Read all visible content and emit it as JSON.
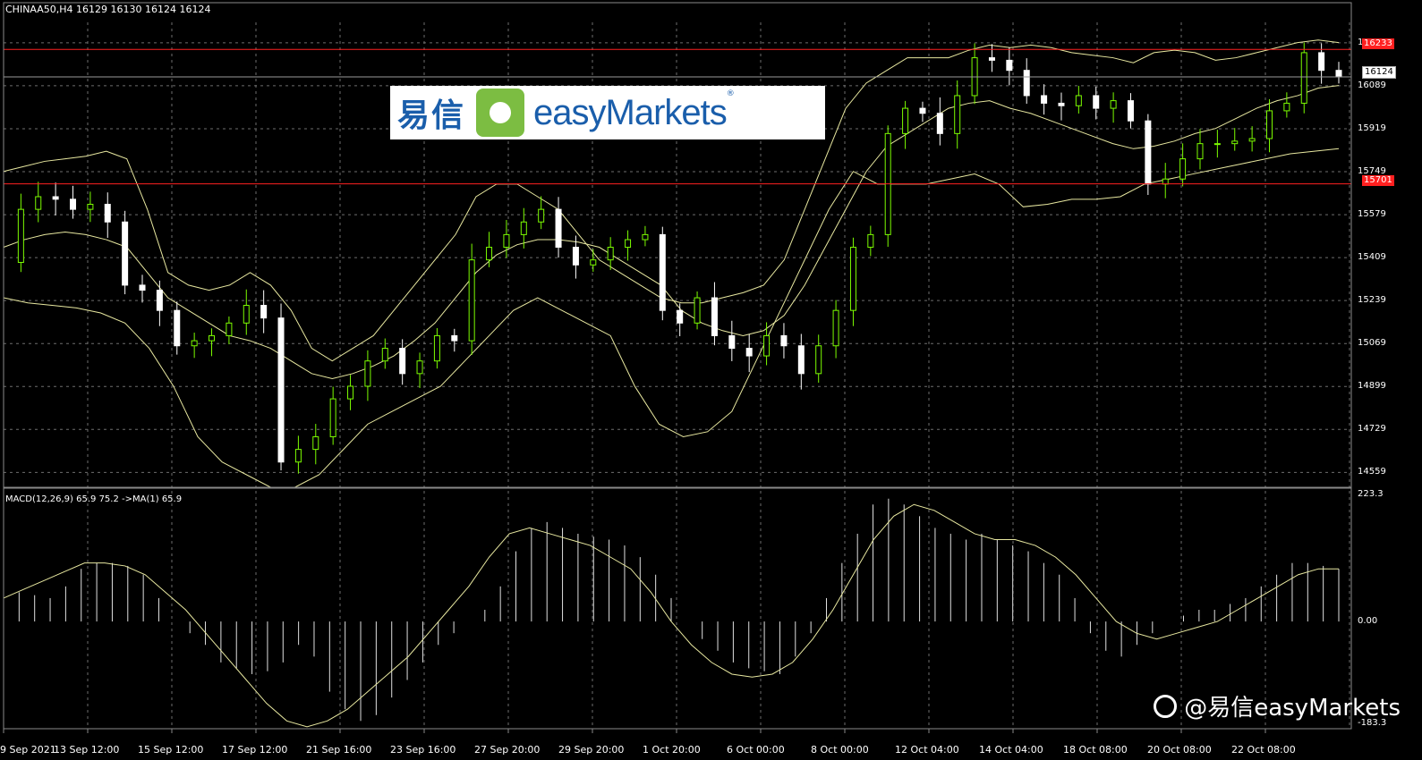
{
  "header": {
    "symbol_info": "CHINAA50,H4  16129 16130 16124 16124",
    "macd_info": "MACD(12,26,9) 65.9 75.2  ->MA(1) 65.9"
  },
  "price_axis": {
    "ticks": [
      "16259",
      "16089",
      "15919",
      "15749",
      "15579",
      "15409",
      "15239",
      "15069",
      "14899",
      "14729",
      "14559"
    ],
    "labels": {
      "resistance": "16233",
      "current": "16124",
      "support": "15701"
    }
  },
  "macd_axis": {
    "ticks": [
      "223.3",
      "0.00",
      "-183.3"
    ]
  },
  "time_axis": {
    "ticks": [
      "9 Sep 2021",
      "13 Sep 12:00",
      "15 Sep 12:00",
      "17 Sep 12:00",
      "21 Sep 16:00",
      "23 Sep 16:00",
      "27 Sep 20:00",
      "29 Sep 20:00",
      "1 Oct 20:00",
      "6 Oct 00:00",
      "8 Oct 00:00",
      "12 Oct 04:00",
      "14 Oct 04:00",
      "18 Oct 08:00",
      "20 Oct 08:00",
      "22 Oct 08:00"
    ]
  },
  "logo": {
    "cn": "易信",
    "en": "easyMarkets",
    "reg": "®"
  },
  "watermark": {
    "text": "@易信easyMarkets",
    "icon": "weibo-icon"
  },
  "colors": {
    "background": "#000000",
    "bull": "#7cfc00",
    "bear": "#ffffff",
    "band": "#e8e8a0",
    "hline": "#ff2020",
    "grid": "#6e6e6e",
    "brand_blue": "#1a5eab",
    "brand_green": "#7cbd42"
  },
  "chart_data": [
    {
      "type": "line",
      "title": "CHINAA50,H4",
      "description_values": {
        "ylim": [
          14500,
          16340
        ],
        "horizontal_levels": [
          16233,
          15701
        ],
        "last_price": 16124,
        "close_series": [
          15390,
          15600,
          15650,
          15640,
          15600,
          15620,
          15550,
          15300,
          15280,
          15200,
          15060,
          15080,
          15100,
          15150,
          15220,
          15170,
          14600,
          14650,
          14700,
          14850,
          14900,
          15000,
          15050,
          14950,
          15000,
          15100,
          15080,
          15400,
          15450,
          15500,
          15550,
          15600,
          15450,
          15380,
          15400,
          15450,
          15480,
          15500,
          15200,
          15150,
          15250,
          15100,
          15050,
          15020,
          15100,
          15060,
          14950,
          15060,
          15200,
          15450,
          15500,
          15900,
          16000,
          15980,
          15900,
          16050,
          16200,
          16190,
          16150,
          16050,
          16020,
          16010,
          16050,
          16000,
          16030,
          15950,
          15700,
          15720,
          15800,
          15860,
          15860,
          15870,
          15880,
          15990,
          16020,
          16220,
          16150,
          16124
        ]
      },
      "series": [
        {
          "name": "upper",
          "values": [
            15750,
            15770,
            15790,
            15800,
            15810,
            15830,
            15800,
            15600,
            15350,
            15300,
            15280,
            15300,
            15350,
            15300,
            15200,
            15050,
            15000,
            15050,
            15100,
            15200,
            15300,
            15400,
            15500,
            15650,
            15700,
            15700,
            15650,
            15600,
            15500,
            15400,
            15350,
            15300,
            15250,
            15230,
            15230,
            15250,
            15270,
            15300,
            15400,
            15600,
            15800,
            16000,
            16100,
            16150,
            16200,
            16200,
            16200,
            16230,
            16250,
            16240,
            16250,
            16240,
            16220,
            16210,
            16200,
            16180,
            16220,
            16230,
            16220,
            16190,
            16200,
            16220,
            16240,
            16260,
            16270,
            16260
          ]
        },
        {
          "name": "middle",
          "values": [
            15450,
            15480,
            15500,
            15510,
            15500,
            15480,
            15450,
            15350,
            15250,
            15200,
            15150,
            15100,
            15080,
            15050,
            15000,
            14950,
            14930,
            14950,
            14980,
            15020,
            15080,
            15150,
            15250,
            15350,
            15420,
            15460,
            15480,
            15480,
            15470,
            15450,
            15400,
            15350,
            15300,
            15200,
            15150,
            15120,
            15100,
            15120,
            15180,
            15300,
            15450,
            15600,
            15750,
            15850,
            15900,
            15950,
            16000,
            16020,
            16030,
            16000,
            15980,
            15950,
            15920,
            15890,
            15860,
            15840,
            15850,
            15870,
            15900,
            15920,
            15960,
            16000,
            16030,
            16050,
            16080,
            16090
          ]
        },
        {
          "name": "lower",
          "values": [
            15250,
            15230,
            15220,
            15210,
            15190,
            15150,
            15050,
            14900,
            14700,
            14600,
            14550,
            14500,
            14500,
            14550,
            14650,
            14750,
            14800,
            14850,
            14900,
            15000,
            15100,
            15200,
            15250,
            15200,
            15150,
            15100,
            14900,
            14750,
            14700,
            14720,
            14800,
            15000,
            15200,
            15400,
            15600,
            15750,
            15700,
            15700,
            15700,
            15720,
            15740,
            15700,
            15610,
            15620,
            15640,
            15640,
            15650,
            15700,
            15720,
            15740,
            15760,
            15780,
            15800,
            15820,
            15830,
            15840
          ]
        }
      ]
    },
    {
      "type": "bar",
      "title": "MACD(12,26,9)",
      "ylim": [
        -183.3,
        223.3
      ],
      "series": [
        {
          "name": "MACD",
          "values": [
            40,
            50,
            45,
            40,
            60,
            90,
            100,
            100,
            95,
            80,
            40,
            0,
            -20,
            -40,
            -70,
            -80,
            -90,
            -85,
            -70,
            -40,
            -60,
            -120,
            -150,
            -170,
            -160,
            -130,
            -100,
            -70,
            -40,
            -20,
            0,
            20,
            60,
            120,
            160,
            170,
            160,
            150,
            145,
            140,
            130,
            110,
            80,
            40,
            0,
            -30,
            -50,
            -70,
            -80,
            -85,
            -90,
            -60,
            -20,
            40,
            100,
            150,
            200,
            210,
            200,
            180,
            160,
            150,
            140,
            150,
            140,
            130,
            120,
            100,
            80,
            40,
            -20,
            -50,
            -60,
            -40,
            -20,
            0,
            10,
            20,
            20,
            30,
            40,
            60,
            80,
            100,
            100,
            95,
            90
          ]
        },
        {
          "name": "Signal",
          "values": [
            40,
            55,
            70,
            85,
            100,
            100,
            95,
            80,
            50,
            20,
            -20,
            -60,
            -100,
            -140,
            -170,
            -180,
            -170,
            -150,
            -120,
            -90,
            -60,
            -20,
            20,
            60,
            110,
            150,
            160,
            150,
            140,
            130,
            110,
            90,
            50,
            0,
            -40,
            -70,
            -90,
            -95,
            -90,
            -70,
            -30,
            20,
            80,
            140,
            180,
            200,
            190,
            170,
            150,
            140,
            140,
            130,
            110,
            80,
            40,
            0,
            -20,
            -30,
            -20,
            -10,
            0,
            20,
            40,
            60,
            80,
            90,
            90
          ]
        }
      ]
    }
  ]
}
